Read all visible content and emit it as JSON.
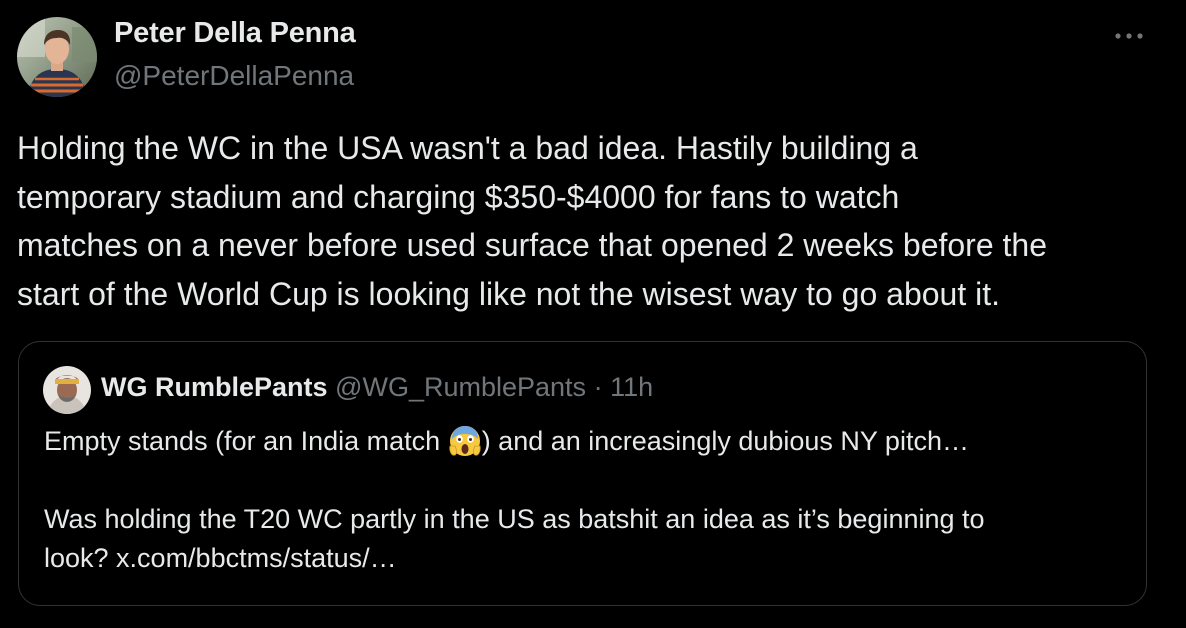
{
  "author": {
    "name": "Peter Della Penna",
    "handle": "@PeterDellaPenna"
  },
  "more_icon": "ellipsis-icon",
  "tweet_text": {
    "lines": [
      "Holding the WC in the USA wasn't a bad idea. Hastily building a",
      "temporary stadium and charging $350-$4000 for fans to watch",
      "matches on a never before used surface that opened 2 weeks before the",
      "start of the World Cup is looking like not the wisest way to go about it."
    ]
  },
  "quoted_tweet": {
    "name": "WG RumblePants",
    "handle": "@WG_RumblePants",
    "separator": "·",
    "time": "11h",
    "text_line1_before": "Empty stands (for an India match ",
    "emoji": "face-screaming-in-fear-emoji",
    "text_line1_after": ") and an increasingly dubious NY pitch…",
    "text_line2": "Was holding the T20 WC partly in the US as batshit an idea as it’s beginning to",
    "text_line3": "look? x.com/bbctms/status/…"
  },
  "colors": {
    "background": "#000000",
    "primary_text": "#e7e9ea",
    "secondary_text": "#71767b",
    "border": "#2f3336"
  }
}
